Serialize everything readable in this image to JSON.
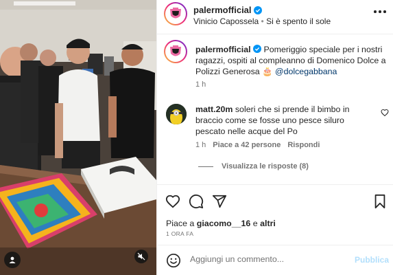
{
  "colors": {
    "accent": "#0095f6",
    "muted": "#737373",
    "publish_disabled": "#b2dffc",
    "mention": "#00376b"
  },
  "header": {
    "username": "palermofficial",
    "subtitle_author": "Vinicio Capossela",
    "subtitle_separator": "•",
    "subtitle_song": "Si è spento il sole"
  },
  "caption": {
    "username": "palermofficial",
    "text": "Pomeriggio speciale per i nostri ragazzi, ospiti al compleanno di Domenico Dolce a Polizzi Generosa 🎂",
    "mention": "@dolcegabbana",
    "time": "1 h"
  },
  "comment": {
    "username": "matt.20m",
    "text": "soleri che si prende il bimbo in braccio come se fosse uno pesce siluro pescato nelle acque del Po",
    "time": "1 h",
    "likes": "Piace a 42 persone",
    "reply": "Rispondi",
    "view_replies": "Visualizza le risposte (8)"
  },
  "likes": {
    "prefix": "Piace a",
    "user": "giacomo__16",
    "conjunction": "e",
    "others": "altri"
  },
  "post_date": "1 ORA FA",
  "add_comment": {
    "placeholder": "Aggiungi un commento...",
    "publish": "Pubblica"
  }
}
